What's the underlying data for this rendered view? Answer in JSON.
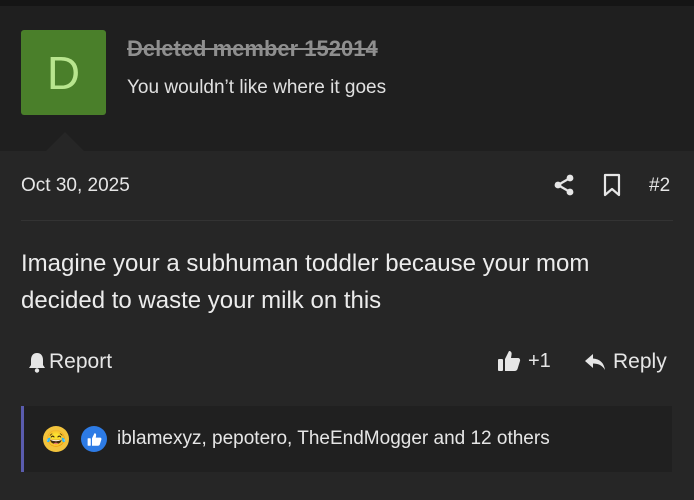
{
  "author": {
    "avatar_letter": "D",
    "name": "Deleted member 152014",
    "title": "You wouldn’t like where it goes"
  },
  "post": {
    "date": "Oct 30, 2025",
    "number": "#2",
    "body": "Imagine your a subhuman toddler because your mom decided to waste your milk on this"
  },
  "actions": {
    "report_label": "Report",
    "like_count": "+1",
    "reply_label": "Reply"
  },
  "reactions": {
    "emoji": "😂",
    "summary": "iblamexyz, pepotero, TheEndMogger and 12 others"
  },
  "icons": [
    "share-icon",
    "bookmark-icon",
    "bell-icon",
    "thumbs-up-icon",
    "reply-arrow-icon"
  ],
  "colors": {
    "avatar": "#4a7f2a",
    "reaction_border": "#5a5cae",
    "like_reaction": "#2d7be5"
  }
}
